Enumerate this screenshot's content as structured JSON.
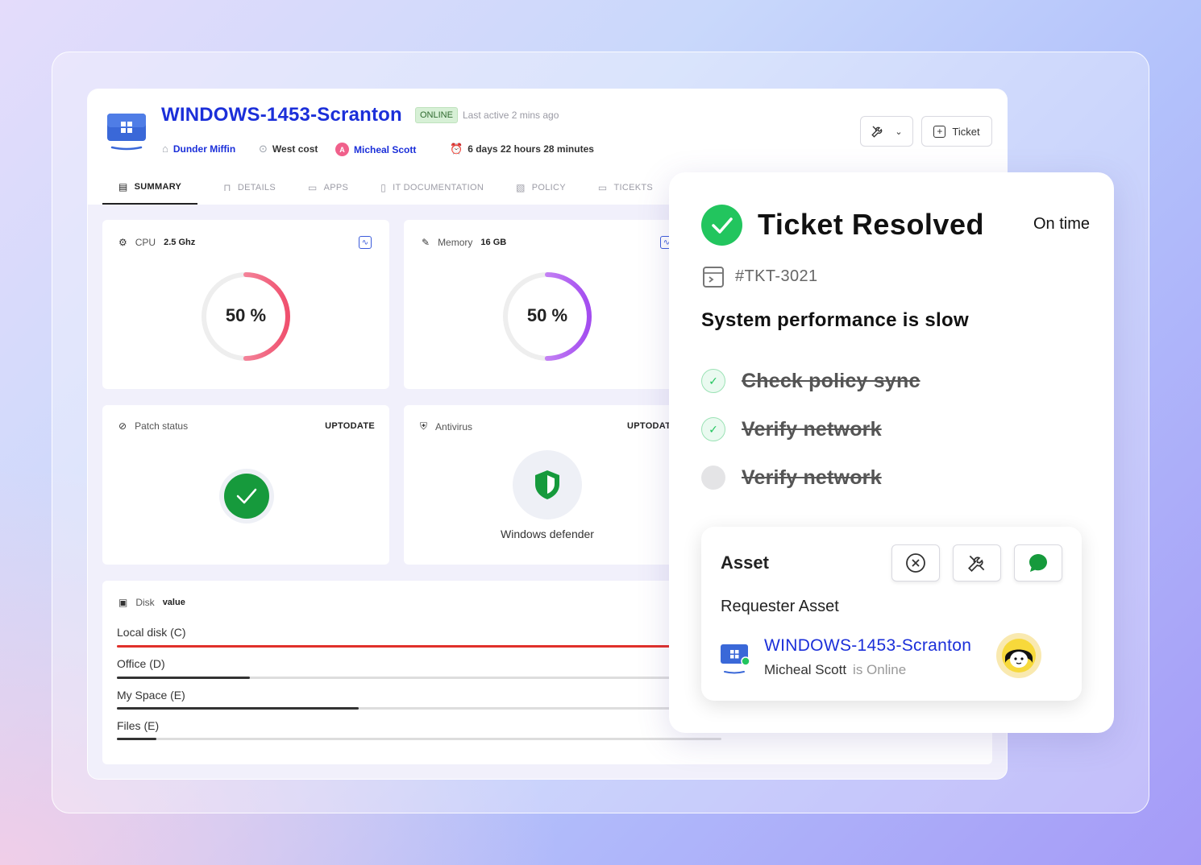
{
  "device": {
    "name": "WINDOWS-1453-Scranton",
    "status": "ONLINE",
    "last_active": "Last active 2 mins ago",
    "org": "Dunder Miffin",
    "location": "West cost",
    "user_initial": "A",
    "user": "Micheal Scott",
    "uptime": "6 days 22 hours 28 minutes"
  },
  "toolbar": {
    "ticket_label": "Ticket"
  },
  "tabs": [
    {
      "label": "SUMMARY",
      "icon": "summary-icon"
    },
    {
      "label": "DETAILS",
      "icon": "details-icon"
    },
    {
      "label": "APPS",
      "icon": "apps-icon"
    },
    {
      "label": "IT DOCUMENTATION",
      "icon": "doc-icon"
    },
    {
      "label": "POLICY",
      "icon": "policy-icon"
    },
    {
      "label": "TICEKTS",
      "icon": "tickets-icon"
    }
  ],
  "cpu": {
    "label": "CPU",
    "value": "2.5 Ghz",
    "percent_text": "50 %",
    "percent": 50,
    "color": "#f0506e"
  },
  "memory": {
    "label": "Memory",
    "value": "16 GB",
    "percent_text": "50 %",
    "percent": 50,
    "color": "#a34cf0"
  },
  "patch": {
    "label": "Patch status",
    "status": "UPTODATE"
  },
  "antivirus": {
    "label": "Antivirus",
    "status": "UPTODAT",
    "product": "Windows defender"
  },
  "disk": {
    "label": "Disk",
    "value": "value",
    "items": [
      {
        "name": "Local disk (C)",
        "usage": 0.95,
        "color": "#e0302a"
      },
      {
        "name": "Office (D)",
        "usage": 0.22,
        "color": "#333333"
      },
      {
        "name": "My Space (E)",
        "usage": 0.4,
        "color": "#333333"
      },
      {
        "name": "Files (E)",
        "usage": 0.065,
        "color": "#333333"
      }
    ]
  },
  "ticket": {
    "title": "Ticket Resolved",
    "timing": "On time",
    "id": "#TKT-3021",
    "issue": "System performance is slow",
    "tasks": [
      {
        "text": "Check policy sync",
        "done": true
      },
      {
        "text": "Verify network",
        "done": true
      },
      {
        "text": "Verify network",
        "done": false
      }
    ],
    "asset": {
      "title": "Asset",
      "subtitle": "Requester Asset",
      "device": "WINDOWS-1453-Scranton",
      "user": "Micheal Scott",
      "presence": "is Online"
    }
  }
}
